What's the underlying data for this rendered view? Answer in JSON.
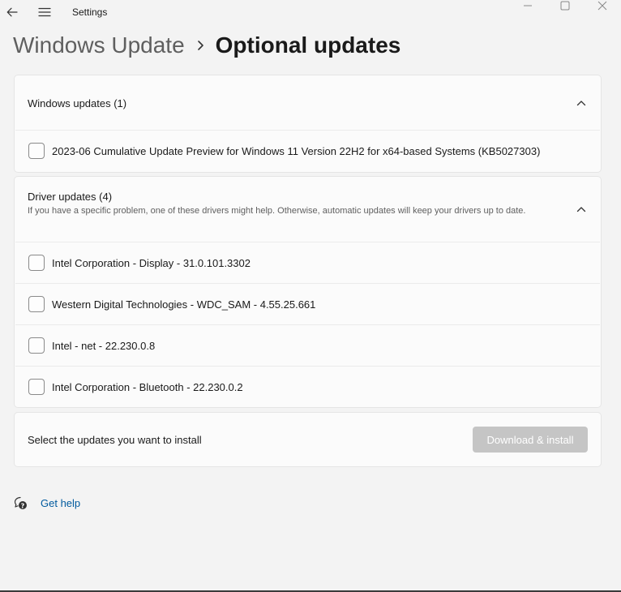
{
  "window": {
    "app_title": "Settings",
    "icons": {
      "back": "back-arrow-icon",
      "menu": "hamburger-menu-icon",
      "minimize": "minimize-icon",
      "maximize": "maximize-icon",
      "close": "close-icon"
    }
  },
  "breadcrumb": {
    "parent": "Windows Update",
    "current": "Optional updates"
  },
  "windows_updates": {
    "title": "Windows updates (1)",
    "items": [
      {
        "label": "2023-06 Cumulative Update Preview for Windows 11 Version 22H2 for x64-based Systems (KB5027303)",
        "checked": false
      }
    ]
  },
  "driver_updates": {
    "title": "Driver updates (4)",
    "description": "If you have a specific problem, one of these drivers might help. Otherwise, automatic updates will keep your drivers up to date.",
    "items": [
      {
        "label": "Intel Corporation - Display - 31.0.101.3302",
        "checked": false
      },
      {
        "label": "Western Digital Technologies - WDC_SAM - 4.55.25.661",
        "checked": false
      },
      {
        "label": "Intel - net - 22.230.0.8",
        "checked": false
      },
      {
        "label": "Intel Corporation - Bluetooth - 22.230.0.2",
        "checked": false
      }
    ]
  },
  "install": {
    "prompt": "Select the updates you want to install",
    "button_label": "Download & install",
    "button_enabled": false
  },
  "help": {
    "label": "Get help"
  },
  "colors": {
    "link": "#005a9e",
    "disabled_button": "#c5c5c5",
    "background": "#f3f3f3"
  }
}
